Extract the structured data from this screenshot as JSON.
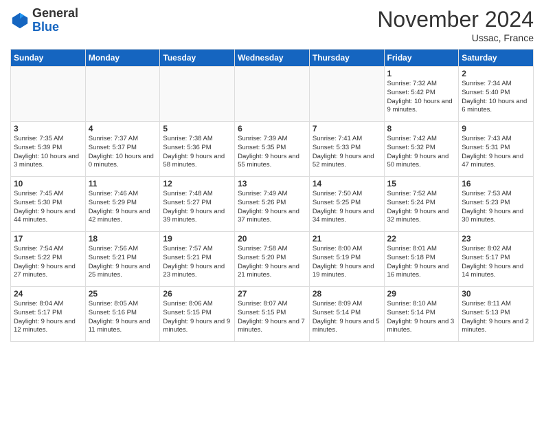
{
  "header": {
    "logo_general": "General",
    "logo_blue": "Blue",
    "month_title": "November 2024",
    "location": "Ussac, France"
  },
  "weekdays": [
    "Sunday",
    "Monday",
    "Tuesday",
    "Wednesday",
    "Thursday",
    "Friday",
    "Saturday"
  ],
  "weeks": [
    [
      {
        "day": "",
        "info": ""
      },
      {
        "day": "",
        "info": ""
      },
      {
        "day": "",
        "info": ""
      },
      {
        "day": "",
        "info": ""
      },
      {
        "day": "",
        "info": ""
      },
      {
        "day": "1",
        "info": "Sunrise: 7:32 AM\nSunset: 5:42 PM\nDaylight: 10 hours and 9 minutes."
      },
      {
        "day": "2",
        "info": "Sunrise: 7:34 AM\nSunset: 5:40 PM\nDaylight: 10 hours and 6 minutes."
      }
    ],
    [
      {
        "day": "3",
        "info": "Sunrise: 7:35 AM\nSunset: 5:39 PM\nDaylight: 10 hours and 3 minutes."
      },
      {
        "day": "4",
        "info": "Sunrise: 7:37 AM\nSunset: 5:37 PM\nDaylight: 10 hours and 0 minutes."
      },
      {
        "day": "5",
        "info": "Sunrise: 7:38 AM\nSunset: 5:36 PM\nDaylight: 9 hours and 58 minutes."
      },
      {
        "day": "6",
        "info": "Sunrise: 7:39 AM\nSunset: 5:35 PM\nDaylight: 9 hours and 55 minutes."
      },
      {
        "day": "7",
        "info": "Sunrise: 7:41 AM\nSunset: 5:33 PM\nDaylight: 9 hours and 52 minutes."
      },
      {
        "day": "8",
        "info": "Sunrise: 7:42 AM\nSunset: 5:32 PM\nDaylight: 9 hours and 50 minutes."
      },
      {
        "day": "9",
        "info": "Sunrise: 7:43 AM\nSunset: 5:31 PM\nDaylight: 9 hours and 47 minutes."
      }
    ],
    [
      {
        "day": "10",
        "info": "Sunrise: 7:45 AM\nSunset: 5:30 PM\nDaylight: 9 hours and 44 minutes."
      },
      {
        "day": "11",
        "info": "Sunrise: 7:46 AM\nSunset: 5:29 PM\nDaylight: 9 hours and 42 minutes."
      },
      {
        "day": "12",
        "info": "Sunrise: 7:48 AM\nSunset: 5:27 PM\nDaylight: 9 hours and 39 minutes."
      },
      {
        "day": "13",
        "info": "Sunrise: 7:49 AM\nSunset: 5:26 PM\nDaylight: 9 hours and 37 minutes."
      },
      {
        "day": "14",
        "info": "Sunrise: 7:50 AM\nSunset: 5:25 PM\nDaylight: 9 hours and 34 minutes."
      },
      {
        "day": "15",
        "info": "Sunrise: 7:52 AM\nSunset: 5:24 PM\nDaylight: 9 hours and 32 minutes."
      },
      {
        "day": "16",
        "info": "Sunrise: 7:53 AM\nSunset: 5:23 PM\nDaylight: 9 hours and 30 minutes."
      }
    ],
    [
      {
        "day": "17",
        "info": "Sunrise: 7:54 AM\nSunset: 5:22 PM\nDaylight: 9 hours and 27 minutes."
      },
      {
        "day": "18",
        "info": "Sunrise: 7:56 AM\nSunset: 5:21 PM\nDaylight: 9 hours and 25 minutes."
      },
      {
        "day": "19",
        "info": "Sunrise: 7:57 AM\nSunset: 5:21 PM\nDaylight: 9 hours and 23 minutes."
      },
      {
        "day": "20",
        "info": "Sunrise: 7:58 AM\nSunset: 5:20 PM\nDaylight: 9 hours and 21 minutes."
      },
      {
        "day": "21",
        "info": "Sunrise: 8:00 AM\nSunset: 5:19 PM\nDaylight: 9 hours and 19 minutes."
      },
      {
        "day": "22",
        "info": "Sunrise: 8:01 AM\nSunset: 5:18 PM\nDaylight: 9 hours and 16 minutes."
      },
      {
        "day": "23",
        "info": "Sunrise: 8:02 AM\nSunset: 5:17 PM\nDaylight: 9 hours and 14 minutes."
      }
    ],
    [
      {
        "day": "24",
        "info": "Sunrise: 8:04 AM\nSunset: 5:17 PM\nDaylight: 9 hours and 12 minutes."
      },
      {
        "day": "25",
        "info": "Sunrise: 8:05 AM\nSunset: 5:16 PM\nDaylight: 9 hours and 11 minutes."
      },
      {
        "day": "26",
        "info": "Sunrise: 8:06 AM\nSunset: 5:15 PM\nDaylight: 9 hours and 9 minutes."
      },
      {
        "day": "27",
        "info": "Sunrise: 8:07 AM\nSunset: 5:15 PM\nDaylight: 9 hours and 7 minutes."
      },
      {
        "day": "28",
        "info": "Sunrise: 8:09 AM\nSunset: 5:14 PM\nDaylight: 9 hours and 5 minutes."
      },
      {
        "day": "29",
        "info": "Sunrise: 8:10 AM\nSunset: 5:14 PM\nDaylight: 9 hours and 3 minutes."
      },
      {
        "day": "30",
        "info": "Sunrise: 8:11 AM\nSunset: 5:13 PM\nDaylight: 9 hours and 2 minutes."
      }
    ]
  ]
}
